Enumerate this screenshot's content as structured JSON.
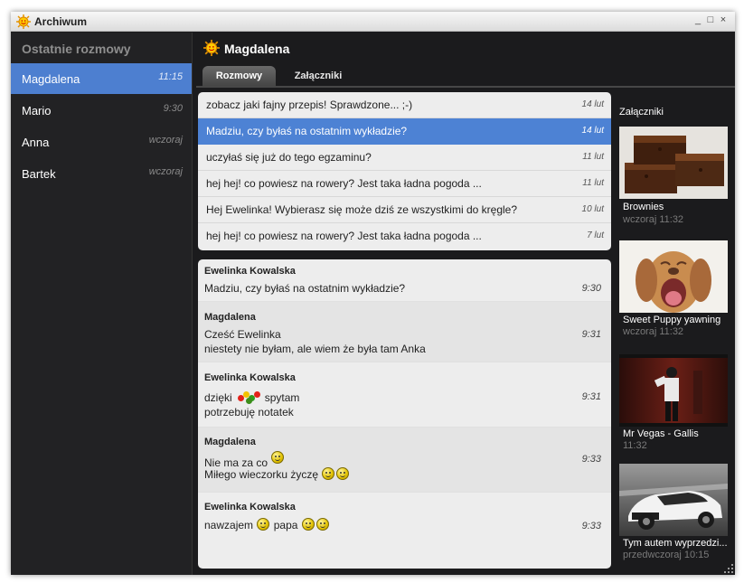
{
  "window": {
    "title": "Archiwum",
    "controls": [
      "_",
      "□",
      "×"
    ]
  },
  "sidebar": {
    "title": "Ostatnie rozmowy",
    "contacts": [
      {
        "name": "Magdalena",
        "time": "11:15",
        "active": true
      },
      {
        "name": "Mario",
        "time": "9:30",
        "active": false
      },
      {
        "name": "Anna",
        "time": "wczoraj",
        "active": false
      },
      {
        "name": "Bartek",
        "time": "wczoraj",
        "active": false
      }
    ]
  },
  "header": {
    "name": "Magdalena"
  },
  "tabs": [
    {
      "label": "Rozmowy",
      "active": true
    },
    {
      "label": "Załączniki",
      "active": false
    }
  ],
  "conversations": [
    {
      "text": "zobacz jaki fajny przepis! Sprawdzone... ;-)",
      "date": "14 lut",
      "selected": false
    },
    {
      "text": "Madziu, czy byłaś na ostatnim wykładzie?",
      "date": "14 lut",
      "selected": true
    },
    {
      "text": "uczyłaś się już do tego egzaminu?",
      "date": "11 lut",
      "selected": false
    },
    {
      "text": "hej hej! co powiesz na rowery? Jest taka ładna pogoda ...",
      "date": "11 lut",
      "selected": false
    },
    {
      "text": "Hej Ewelinka! Wybierasz się może dziś ze wszystkimi do kręgle?",
      "date": "10 lut",
      "selected": false
    },
    {
      "text": "hej hej! co powiesz na rowery? Jest taka ładna pogoda ...",
      "date": "7 lut",
      "selected": false
    }
  ],
  "messages": [
    {
      "author": "Ewelinka Kowalska",
      "lines": [
        "Madziu, czy byłaś na ostatnim wykładzie?"
      ],
      "time": "9:30"
    },
    {
      "author": "Magdalena",
      "lines": [
        "Cześć Ewelinka",
        "niestety nie byłam, ale wiem że była tam Anka"
      ],
      "time": "9:31"
    },
    {
      "author": "Ewelinka Kowalska",
      "lines": [
        "dzięki",
        "spytam",
        "potrzebuję notatek"
      ],
      "time": "9:31",
      "icons": [
        "flowers-icon"
      ]
    },
    {
      "author": "Magdalena",
      "lines": [
        "Nie ma za co",
        "Miłego wieczorku życzę"
      ],
      "time": "9:33",
      "icons": [
        "smiley-icon",
        "wink-icon"
      ]
    },
    {
      "author": "Ewelinka Kowalska",
      "lines": [
        "nawzajem",
        "papa"
      ],
      "time": "9:33",
      "icons": [
        "smiley-icon",
        "wink-icon"
      ]
    }
  ],
  "attachments": {
    "title": "Załączniki",
    "items": [
      {
        "name": "Brownies",
        "date": "wczoraj 11:32",
        "icon": "brownies-photo"
      },
      {
        "name": "Sweet Puppy yawning",
        "date": "wczoraj 11:32",
        "icon": "puppy-photo"
      },
      {
        "name": "Mr Vegas - Gallis",
        "date": "11:32",
        "icon": "video-thumbnail"
      },
      {
        "name": "Tym autem wyprzedzi...",
        "date": "przedwczoraj 10:15",
        "icon": "car-photo"
      }
    ]
  },
  "colors": {
    "accent": "#4d7fd0",
    "background": "#1b1b1d",
    "panel": "#ededed"
  }
}
